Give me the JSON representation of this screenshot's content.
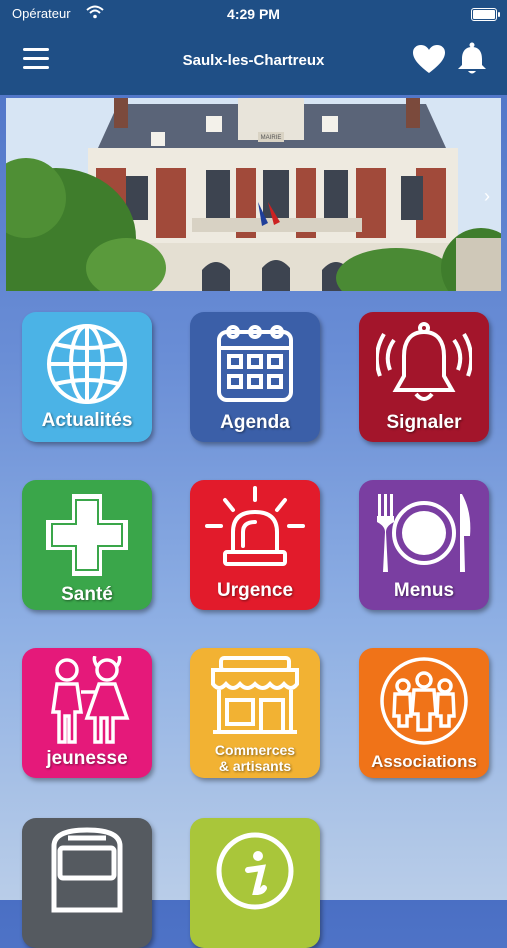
{
  "status_bar": {
    "carrier": "Opérateur",
    "time": "4:29 PM"
  },
  "header": {
    "title": "Saulx-les-Chartreux",
    "background_color": "#1f4f86"
  },
  "banner": {
    "building_sign": "MAIRIE"
  },
  "tiles": [
    {
      "label": "Actualités",
      "icon": "globe-icon",
      "color": "#4bb3e6"
    },
    {
      "label": "Agenda",
      "icon": "calendar-icon",
      "color": "#3b5fa8"
    },
    {
      "label": "Signaler",
      "icon": "bell-alert-icon",
      "color": "#a3152b"
    },
    {
      "label": "Santé",
      "icon": "medical-cross-icon",
      "color": "#3aa64a"
    },
    {
      "label": "Urgence",
      "icon": "siren-icon",
      "color": "#e21b2b"
    },
    {
      "label": "Menus",
      "icon": "plate-cutlery-icon",
      "color": "#7a3ea1"
    },
    {
      "label": "jeunesse",
      "icon": "children-icon",
      "color": "#e5197a"
    },
    {
      "label_line1": "Commerces",
      "label_line2": "& artisants",
      "icon": "shop-icon",
      "color": "#f2b233"
    },
    {
      "label": "Associations",
      "icon": "group-icon",
      "color": "#f07318"
    },
    {
      "label": "",
      "icon": "bus-icon",
      "color": "#555a60"
    },
    {
      "label": "",
      "icon": "info-icon",
      "color": "#a9c63a"
    }
  ]
}
